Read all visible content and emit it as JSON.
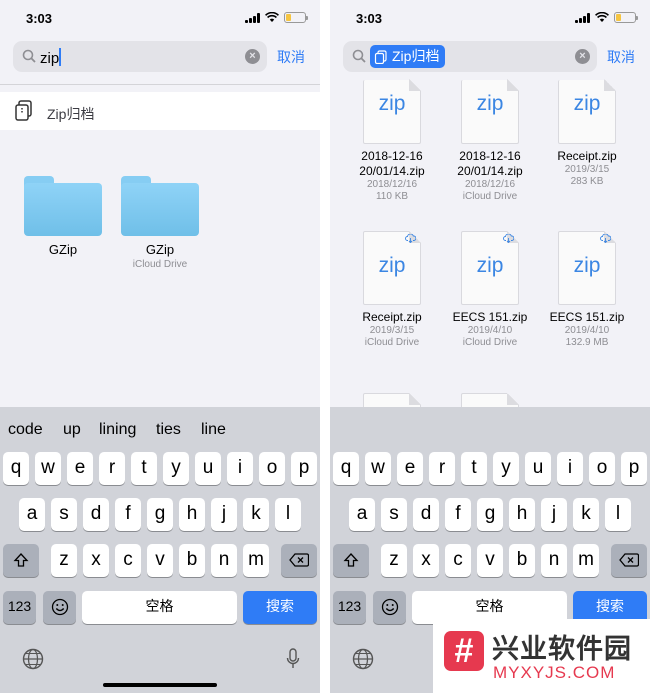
{
  "left": {
    "status": {
      "time": "3:03"
    },
    "search": {
      "query": "zip",
      "cancel_label": "取消",
      "clear_glyph": "×"
    },
    "suggestion": {
      "label": "Zip归档",
      "icon": "zip-archive-icon"
    },
    "folders": [
      {
        "name": "GZip",
        "location": ""
      },
      {
        "name": "GZip",
        "location": "iCloud Drive"
      }
    ]
  },
  "right": {
    "status": {
      "time": "3:03"
    },
    "search": {
      "token_label": "Zip归档",
      "cancel_label": "取消",
      "clear_glyph": "×"
    },
    "files": [
      {
        "ext": "zip",
        "name_line1": "2018-12-16",
        "name_line2": "20/01/14.zip",
        "date": "2018/12/16",
        "meta": "110 KB",
        "cloud": false
      },
      {
        "ext": "zip",
        "name_line1": "2018-12-16",
        "name_line2": "20/01/14.zip",
        "date": "2018/12/16",
        "meta": "iCloud Drive",
        "cloud": false
      },
      {
        "ext": "zip",
        "name_line1": "Receipt.zip",
        "name_line2": "",
        "date": "2019/3/15",
        "meta": "283 KB",
        "cloud": false
      },
      {
        "ext": "zip",
        "name_line1": "Receipt.zip",
        "name_line2": "",
        "date": "2019/3/15",
        "meta": "iCloud Drive",
        "cloud": true
      },
      {
        "ext": "zip",
        "name_line1": "EECS 151.zip",
        "name_line2": "",
        "date": "2019/4/10",
        "meta": "iCloud Drive",
        "cloud": true
      },
      {
        "ext": "zip",
        "name_line1": "EECS 151.zip",
        "name_line2": "",
        "date": "2019/4/10",
        "meta": "132.9 MB",
        "cloud": true
      }
    ]
  },
  "keyboard": {
    "predictions": [
      "code",
      "up",
      "lining",
      "ties",
      "line"
    ],
    "row1": [
      "q",
      "w",
      "e",
      "r",
      "t",
      "y",
      "u",
      "i",
      "o",
      "p"
    ],
    "row2": [
      "a",
      "s",
      "d",
      "f",
      "g",
      "h",
      "j",
      "k",
      "l"
    ],
    "row3": [
      "z",
      "x",
      "c",
      "v",
      "b",
      "n",
      "m"
    ],
    "numbers_label": "123",
    "space_label": "空格",
    "search_label": "搜索"
  },
  "watermark": {
    "logo_glyph": "#",
    "title": "兴业软件园",
    "url": "MYXYJS.COM"
  },
  "colors": {
    "accent": "#2f7cf6",
    "keyboard_bg": "#d1d3d9",
    "folder_blue": "#7cc8ef",
    "watermark_red": "#e6394f"
  }
}
